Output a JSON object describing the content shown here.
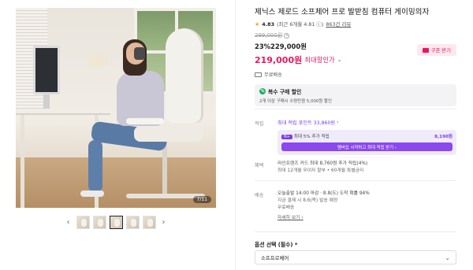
{
  "gallery": {
    "counter": "7/11",
    "thumbnail_count": 5,
    "active_thumbnail": 3
  },
  "product": {
    "title": "제닉스 제로드 소프체어 프로 발받침 컴퓨터 게이밍의자",
    "rating": "4.83",
    "rating_detail": "(최근 6개월 4.81 ⓘ)",
    "review_link": "863건 리뷰",
    "original_price": "299,000원",
    "sale_line": "23%229,000원",
    "final_price": "219,000원",
    "final_label": "최대할인가",
    "coupon_button": "쿠폰 받기",
    "free_shipping": "무료배송"
  },
  "multi_discount": {
    "title": "복수 구매 할인",
    "desc": "2개 이상 구매시 수량만큼 5,000원 할인"
  },
  "points": {
    "label": "적립",
    "head": "최대 적립 포인트 33,860원",
    "badge": "N+",
    "extra": "최대 5% 추가 적립",
    "extra_value": "8,190원",
    "button": "멤버십 시작하고 최대 적립 받기 ›"
  },
  "benefit": {
    "label": "혜택",
    "line1": "라인프렌즈 카드 최대 8,760원 추가 적립(4%)",
    "line2": "최대 12개월 무이자 할부 • 60개월 특별금리"
  },
  "delivery": {
    "label": "배송",
    "line1": "오늘출발 14:00 마감 · 8.8(도) 도착 확률 94%",
    "line2": "지금 결제 시 8.6(목) 발송 예정",
    "line3": "무료배송",
    "detail_link": "자세히 보기 ›"
  },
  "option": {
    "label": "옵션 선택 (필수) *",
    "selected": "소프프로체어"
  },
  "colors": {
    "accent": "#e8175d",
    "purple": "#7a3fe4",
    "green": "#19b35b"
  }
}
